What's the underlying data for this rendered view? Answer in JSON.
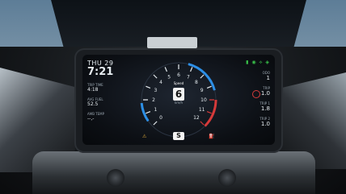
{
  "dashboard": {
    "date": "THU 29",
    "time": "7:21",
    "trip_time_label": "TRIP TIME",
    "trip_time_value": "4:18",
    "avg_fuel_label": "AVG FUEL",
    "avg_fuel_value": "52.5",
    "extra_label": "AMB TEMP",
    "extra_value": "--,-",
    "speed_label": "Speed",
    "gear": "6",
    "unit": "km/h",
    "mode": "S",
    "right_labels": [
      "ODO",
      "TRIP",
      "TRIP 1",
      "TRIP 2"
    ],
    "right_values": [
      "1",
      "1.0",
      "1.8",
      "1.0"
    ],
    "status_icons": "▮ ◉ ⟡ ◈"
  },
  "gauge": {
    "ticks": [
      "0",
      "1",
      "2",
      "3",
      "4",
      "5",
      "6",
      "7",
      "8",
      "9",
      "10",
      "11",
      "12"
    ],
    "needle_value": 0,
    "red_from": 10,
    "blue_color": "#2d8fe6",
    "red_color": "#d63a3a"
  }
}
